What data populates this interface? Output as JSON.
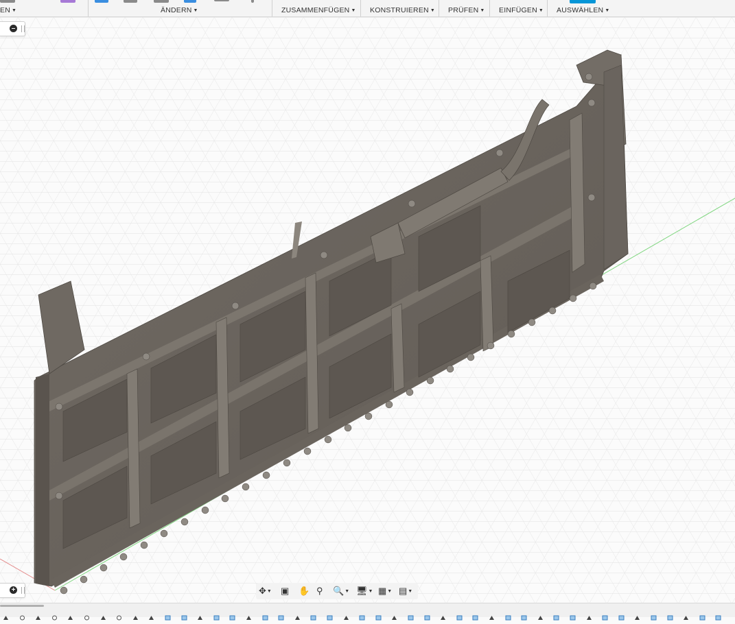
{
  "toolbar": {
    "groups": [
      {
        "label": "EN"
      },
      {
        "label": "ÄNDERN"
      },
      {
        "label": "ZUSAMMENFÜGEN"
      },
      {
        "label": "KONSTRUIEREN"
      },
      {
        "label": "PRÜFEN"
      },
      {
        "label": "EINFÜGEN"
      },
      {
        "label": "AUSWÄHLEN"
      }
    ],
    "accent": "#0696d7"
  },
  "browser_panel": {
    "collapse_icon": "minus-circle-icon"
  },
  "comments_panel": {
    "expand_icon": "plus-circle-icon"
  },
  "navigation_bar": {
    "items": [
      {
        "icon": "orbit-icon",
        "glyph": "✥",
        "has_dropdown": true
      },
      {
        "icon": "look-at-icon",
        "glyph": "▣",
        "has_dropdown": false
      },
      {
        "icon": "pan-icon",
        "glyph": "✋",
        "has_dropdown": false
      },
      {
        "icon": "zoom-icon",
        "glyph": "⚲",
        "has_dropdown": false
      },
      {
        "icon": "fit-icon",
        "glyph": "🔍",
        "has_dropdown": true
      },
      {
        "icon": "display-settings-icon",
        "glyph": "🖥",
        "has_dropdown": true
      },
      {
        "icon": "grid-icon",
        "glyph": "▦",
        "has_dropdown": true
      },
      {
        "icon": "viewports-icon",
        "glyph": "▤",
        "has_dropdown": true
      }
    ]
  },
  "model": {
    "body_color": "#6b655f",
    "panel_color": "#5e5852",
    "highlight_color": "#7e7870",
    "background_color": "#fbfbfb",
    "grid_color": "#e3e3e3",
    "x_axis_color": "#e06060",
    "y_axis_color": "#5fcc5f"
  },
  "timeline": {
    "feature_count": 45
  }
}
